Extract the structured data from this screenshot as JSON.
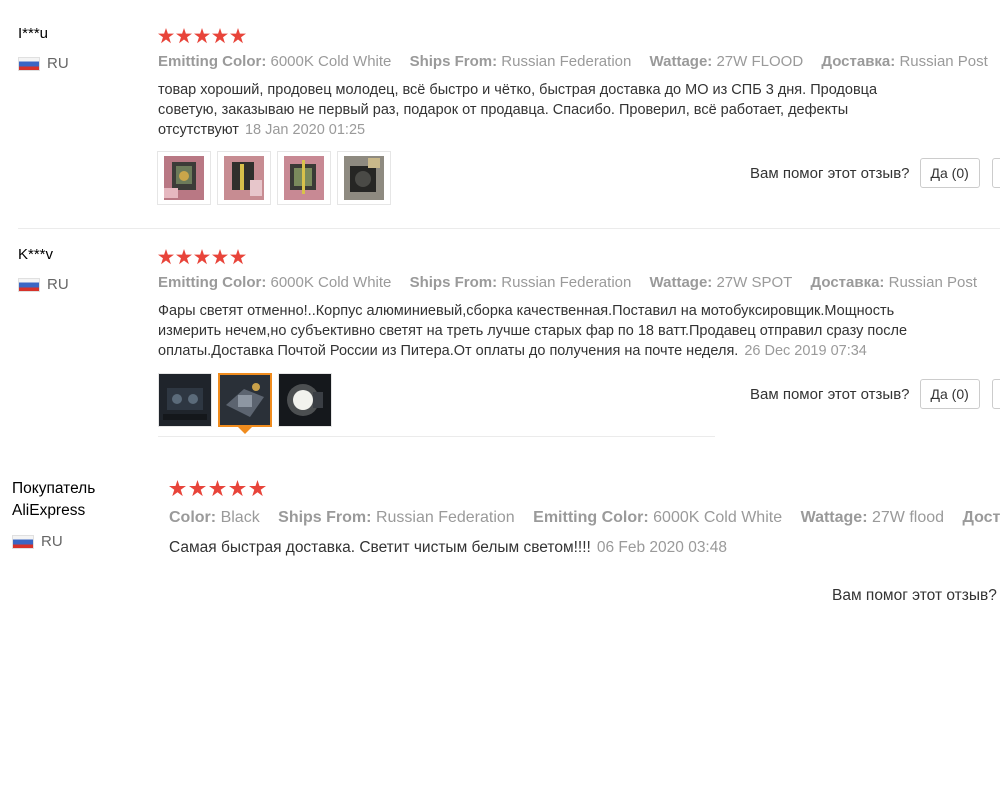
{
  "colors": {
    "star": "#e8443a",
    "selected_thumb_border": "#f08c1e",
    "muted_text": "#9a9a9a",
    "body_text": "#333333"
  },
  "reviews": [
    {
      "author": "I***u",
      "country": "RU",
      "rating": 5,
      "specs": [
        {
          "key": "Emitting Color:",
          "value": "6000K Cold White"
        },
        {
          "key": "Ships From:",
          "value": "Russian Federation"
        },
        {
          "key": "Wattage:",
          "value": "27W FLOOD"
        },
        {
          "key": "Доставка:",
          "value": "Russian Post"
        }
      ],
      "text_lines": [
        "товар хороший, продовец молодец, всё быстро и чётко, быстрая доставка до МО из СПБ 3 дня. Продовца",
        "советую, заказываю не первый раз, подарок от продавца. Спасибо. Проверил, всё работает, дефекты",
        "отсутствуют"
      ],
      "date": "18 Jan 2020 01:25",
      "photos": [
        "photo-1",
        "photo-2",
        "photo-3",
        "photo-4"
      ],
      "helpful_label": "Вам помог этот отзыв?",
      "yes_button": "Да (0)"
    },
    {
      "author": "K***v",
      "country": "RU",
      "rating": 5,
      "specs": [
        {
          "key": "Emitting Color:",
          "value": "6000K Cold White"
        },
        {
          "key": "Ships From:",
          "value": "Russian Federation"
        },
        {
          "key": "Wattage:",
          "value": "27W SPOT"
        },
        {
          "key": "Доставка:",
          "value": "Russian Post"
        }
      ],
      "text_lines": [
        "Фары светят отменно!..Корпус алюминиевый,сборка качественная.Поставил на мотобуксировщик.Мощность",
        "измерить нечем,но субъективно светят на треть лучше старых фар по 18 ватт.Продавец отправил сразу после",
        "оплаты.Доставка Почтой России из Питера.От оплаты до получения на почте неделя."
      ],
      "date": "26 Dec 2019 07:34",
      "photos": [
        "photo-1",
        "photo-2",
        "photo-3"
      ],
      "selected_photo": 1,
      "helpful_label": "Вам помог этот отзыв?",
      "yes_button": "Да (0)"
    },
    {
      "author_lines": [
        "Покупатель",
        "AliExpress"
      ],
      "country": "RU",
      "rating": 5,
      "specs": [
        {
          "key": "Color:",
          "value": "Black"
        },
        {
          "key": "Ships From:",
          "value": "Russian Federation"
        },
        {
          "key": "Emitting Color:",
          "value": "6000K Cold White"
        },
        {
          "key": "Wattage:",
          "value": "27W flood"
        },
        {
          "key": "Доста",
          "value": ""
        }
      ],
      "text_lines": [
        "Самая быстрая доставка. Светит чистым белым светом!!!!"
      ],
      "date": "06 Feb 2020 03:48",
      "helpful_label": "Вам помог этот отзыв?"
    }
  ]
}
